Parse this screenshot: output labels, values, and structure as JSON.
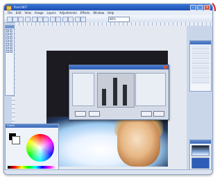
{
  "app": {
    "name": "Paint.NET"
  },
  "menus": [
    "File",
    "Edit",
    "View",
    "Image",
    "Layers",
    "Adjustments",
    "Effects",
    "Window",
    "Help"
  ],
  "toolbar": {
    "zoom_value": "86%"
  },
  "colors_panel": {
    "title": "Colors"
  },
  "accent_colors": {
    "titlebar": "#1c4fb2",
    "highlight": "#d11c2e"
  },
  "icons": [
    "app-icon",
    "minimize-icon",
    "maximize-icon",
    "close-icon",
    "tool-icons",
    "color-wheel"
  ]
}
